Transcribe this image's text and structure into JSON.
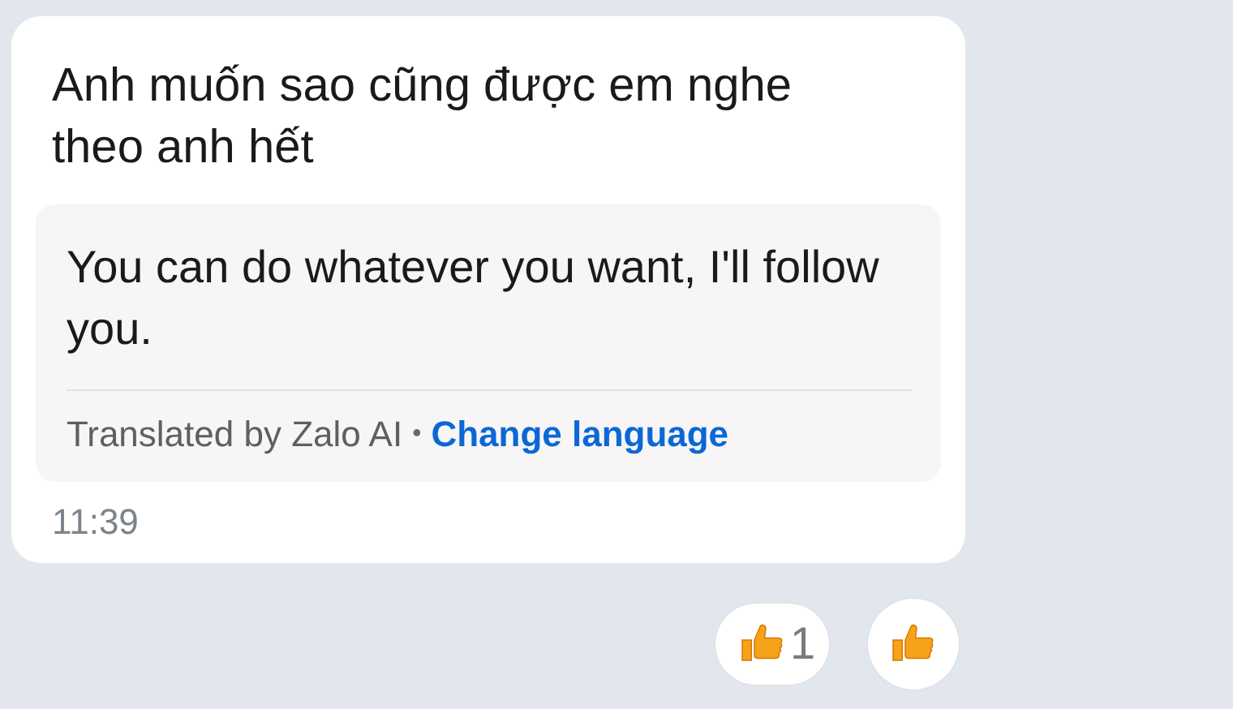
{
  "message": {
    "text": "Anh muốn sao cũng được em nghe theo anh hết",
    "translation": {
      "text": "You can do whatever you want, I'll follow you.",
      "credit": "Translated by Zalo AI",
      "separator": "•",
      "link": "Change language"
    },
    "time": "11:39"
  },
  "reactions": {
    "count": "1"
  }
}
